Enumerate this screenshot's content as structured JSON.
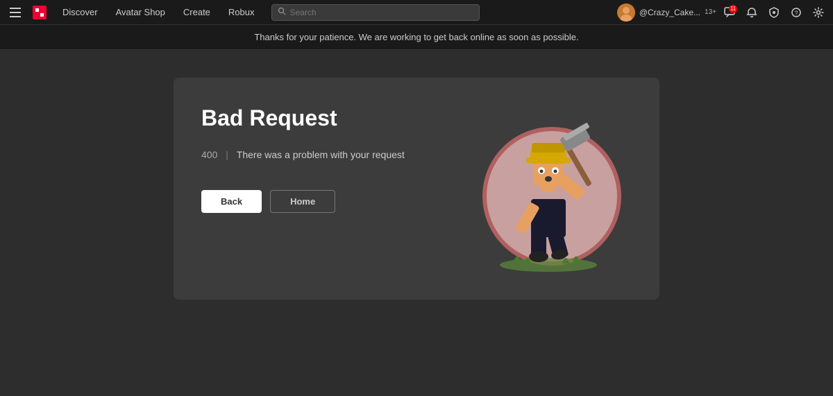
{
  "navbar": {
    "logo_alt": "Roblox logo",
    "links": [
      {
        "label": "Discover",
        "id": "discover"
      },
      {
        "label": "Avatar Shop",
        "id": "avatar-shop"
      },
      {
        "label": "Create",
        "id": "create"
      },
      {
        "label": "Robux",
        "id": "robux"
      }
    ],
    "search_placeholder": "Search",
    "user": {
      "username": "@Crazy_Cake...",
      "age_rating": "13+"
    },
    "notification_count": "11",
    "icons": {
      "hamburger": "☰",
      "search": "🔍",
      "chat": "💬",
      "notifications": "🔔",
      "shield": "🛡",
      "help": "?",
      "settings": "⚙"
    }
  },
  "banner": {
    "text": "Thanks for your patience. We are working to get back online as soon as possible."
  },
  "error_page": {
    "title": "Bad Request",
    "error_code": "400",
    "divider": "|",
    "description": "There was a problem with your request",
    "buttons": {
      "back": "Back",
      "home": "Home"
    }
  }
}
